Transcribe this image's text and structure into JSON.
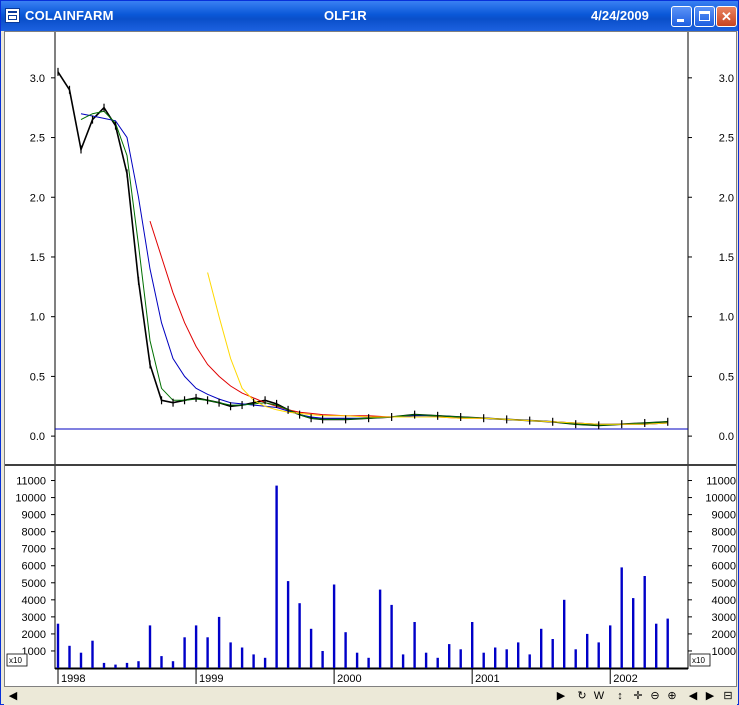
{
  "window": {
    "title_left": "COLAINFARM",
    "title_center": "OLF1R",
    "date": "4/24/2009"
  },
  "price_panel": {
    "y_ticks": [
      "0.0",
      "0.5",
      "1.0",
      "1.5",
      "2.0",
      "2.5",
      "3.0"
    ]
  },
  "volume_panel": {
    "y_ticks": [
      "1000",
      "2000",
      "3000",
      "4000",
      "5000",
      "6000",
      "7000",
      "8000",
      "9000",
      "10000",
      "11000"
    ],
    "multiplier_label": "x10"
  },
  "x_axis": {
    "labels": [
      "1998",
      "1999",
      "2000",
      "2001",
      "2002"
    ]
  },
  "toolbar": {
    "icons": [
      "scroll-left-icon",
      "scroll-right-icon",
      "refresh-icon",
      "week-icon",
      "pan-vertical-icon",
      "move-icon",
      "zoom-out-icon",
      "zoom-in-icon",
      "prev-icon",
      "next-icon",
      "panel-icon"
    ],
    "week_label": "W"
  },
  "colors": {
    "price": "#000000",
    "ma_red": "#e00000",
    "ma_blue": "#0000c0",
    "ma_green": "#007000",
    "ma_yellow": "#ffd800",
    "baseline": "#0000c0",
    "volume": "#0000c8"
  },
  "chart_data": [
    {
      "type": "line",
      "title": "",
      "x": [
        "1998-01",
        "1998-02",
        "1998-03",
        "1998-04",
        "1998-05",
        "1998-06",
        "1998-07",
        "1998-08",
        "1998-09",
        "1998-10",
        "1998-11",
        "1998-12",
        "1999-01",
        "1999-02",
        "1999-03",
        "1999-04",
        "1999-05",
        "1999-06",
        "1999-07",
        "1999-08",
        "1999-09",
        "1999-10",
        "1999-11",
        "1999-12",
        "2000-02",
        "2000-04",
        "2000-06",
        "2000-08",
        "2000-10",
        "2000-12",
        "2001-02",
        "2001-04",
        "2001-06",
        "2001-08",
        "2001-10",
        "2001-12",
        "2002-02",
        "2002-04",
        "2002-06"
      ],
      "series": [
        {
          "values": [
            3.05,
            2.9,
            2.4,
            2.65,
            2.75,
            2.6,
            2.2,
            1.3,
            0.6,
            0.3,
            0.28,
            0.3,
            0.32,
            0.3,
            0.28,
            0.25,
            0.26,
            0.28,
            0.3,
            0.27,
            0.22,
            0.18,
            0.15,
            0.14,
            0.14,
            0.15,
            0.16,
            0.18,
            0.17,
            0.16,
            0.15,
            0.14,
            0.13,
            0.12,
            0.1,
            0.09,
            0.1,
            0.11,
            0.12
          ]
        },
        {
          "values": [
            null,
            null,
            null,
            null,
            null,
            null,
            null,
            null,
            1.8,
            1.5,
            1.2,
            0.95,
            0.75,
            0.6,
            0.5,
            0.42,
            0.36,
            0.32,
            0.28,
            0.25,
            0.22,
            0.2,
            0.19,
            0.18,
            0.17,
            0.17,
            0.16,
            0.16,
            0.16,
            0.15,
            0.15,
            0.14,
            0.13,
            0.12,
            0.11,
            0.1,
            0.1,
            0.1,
            0.11
          ]
        },
        {
          "values": [
            null,
            null,
            2.7,
            2.68,
            2.66,
            2.64,
            2.5,
            2.0,
            1.4,
            0.95,
            0.65,
            0.5,
            0.4,
            0.35,
            0.31,
            0.28,
            0.27,
            0.26,
            0.25,
            0.24,
            0.21,
            0.18,
            0.16,
            0.15,
            0.15,
            0.15,
            0.16,
            0.17,
            0.17,
            0.16,
            0.15,
            0.14,
            0.13,
            0.12,
            0.11,
            0.1,
            0.1,
            0.1,
            0.11
          ]
        },
        {
          "values": [
            null,
            null,
            2.65,
            2.7,
            2.72,
            2.62,
            2.35,
            1.6,
            0.8,
            0.4,
            0.3,
            0.3,
            0.31,
            0.3,
            0.28,
            0.26,
            0.26,
            0.27,
            0.28,
            0.26,
            0.22,
            0.18,
            0.15,
            0.14,
            0.14,
            0.15,
            0.16,
            0.18,
            0.17,
            0.16,
            0.15,
            0.14,
            0.13,
            0.12,
            0.1,
            0.09,
            0.1,
            0.11,
            0.12
          ]
        },
        {
          "values": [
            null,
            null,
            null,
            null,
            null,
            null,
            null,
            null,
            null,
            null,
            null,
            null,
            null,
            1.37,
            1.0,
            0.65,
            0.4,
            0.3,
            0.25,
            0.22,
            0.2,
            0.19,
            0.18,
            0.17,
            0.17,
            0.16,
            0.16,
            0.16,
            0.16,
            0.15,
            0.15,
            0.14,
            0.13,
            0.12,
            0.11,
            0.1,
            0.1,
            0.1,
            0.11
          ]
        }
      ],
      "baseline": 0.06,
      "ylim": [
        -0.2,
        3.3
      ],
      "xlabel": "",
      "ylabel": ""
    },
    {
      "type": "bar",
      "title": "",
      "x": [
        "1998-01",
        "1998-02",
        "1998-03",
        "1998-04",
        "1998-05",
        "1998-06",
        "1998-07",
        "1998-08",
        "1998-09",
        "1998-10",
        "1998-11",
        "1998-12",
        "1999-01",
        "1999-02",
        "1999-03",
        "1999-04",
        "1999-05",
        "1999-06",
        "1999-07",
        "1999-08",
        "1999-09",
        "1999-10",
        "1999-11",
        "1999-12",
        "2000-01",
        "2000-02",
        "2000-03",
        "2000-04",
        "2000-05",
        "2000-06",
        "2000-07",
        "2000-08",
        "2000-09",
        "2000-10",
        "2000-11",
        "2000-12",
        "2001-01",
        "2001-02",
        "2001-03",
        "2001-04",
        "2001-05",
        "2001-06",
        "2001-07",
        "2001-08",
        "2001-09",
        "2001-10",
        "2001-11",
        "2001-12",
        "2002-01",
        "2002-02",
        "2002-03",
        "2002-04",
        "2002-05",
        "2002-06"
      ],
      "values": [
        2600,
        1300,
        900,
        1600,
        300,
        200,
        300,
        400,
        2500,
        700,
        400,
        1800,
        2500,
        1800,
        3000,
        1500,
        1200,
        800,
        600,
        10700,
        5100,
        3800,
        2300,
        1000,
        4900,
        2100,
        900,
        600,
        4600,
        3700,
        800,
        2700,
        900,
        600,
        1400,
        1100,
        2700,
        900,
        1200,
        1100,
        1500,
        800,
        2300,
        1700,
        4000,
        1100,
        2000,
        1500,
        2500,
        5900,
        4100,
        5400,
        2600,
        2900
      ],
      "ylim": [
        0,
        11500
      ],
      "multiplier": "x10",
      "xlabel": "",
      "ylabel": ""
    }
  ]
}
